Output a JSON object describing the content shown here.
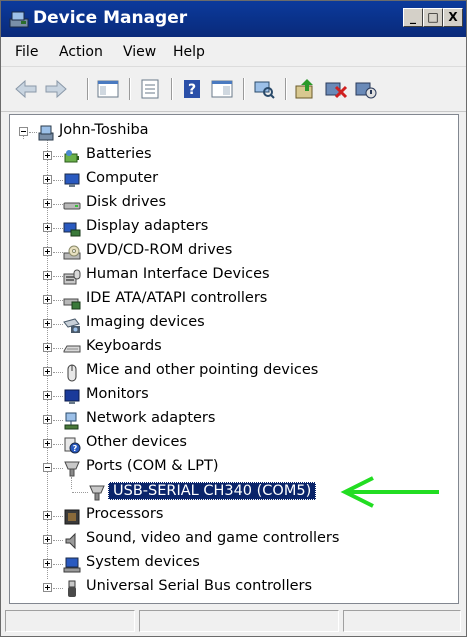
{
  "window": {
    "title": "Device Manager"
  },
  "title_buttons": {
    "minimize": "_",
    "maximize": "□",
    "close": "X"
  },
  "menu": {
    "items": [
      "File",
      "Action",
      "View",
      "Help"
    ]
  },
  "toolbar": {
    "icons": [
      "back-arrow-icon",
      "forward-arrow-icon",
      "show-hide-tree-icon",
      "properties-icon",
      "help-icon",
      "view-icon",
      "scan-hardware-icon",
      "update-driver-icon",
      "uninstall-icon",
      "disable-icon"
    ]
  },
  "tree": {
    "root": {
      "label": "John-Toshiba",
      "icon": "computer-icon"
    },
    "items": [
      {
        "label": "Batteries",
        "icon": "battery-icon",
        "expanded": false
      },
      {
        "label": "Computer",
        "icon": "monitor-icon",
        "expanded": false
      },
      {
        "label": "Disk drives",
        "icon": "disk-drive-icon",
        "expanded": false
      },
      {
        "label": "Display adapters",
        "icon": "display-adapter-icon",
        "expanded": false
      },
      {
        "label": "DVD/CD-ROM drives",
        "icon": "optical-drive-icon",
        "expanded": false
      },
      {
        "label": "Human Interface Devices",
        "icon": "hid-icon",
        "expanded": false
      },
      {
        "label": "IDE ATA/ATAPI controllers",
        "icon": "ide-controller-icon",
        "expanded": false
      },
      {
        "label": "Imaging devices",
        "icon": "camera-icon",
        "expanded": false
      },
      {
        "label": "Keyboards",
        "icon": "keyboard-icon",
        "expanded": false
      },
      {
        "label": "Mice and other pointing devices",
        "icon": "mouse-icon",
        "expanded": false
      },
      {
        "label": "Monitors",
        "icon": "monitor-icon",
        "expanded": false
      },
      {
        "label": "Network adapters",
        "icon": "network-icon",
        "expanded": false
      },
      {
        "label": "Other devices",
        "icon": "unknown-device-icon",
        "expanded": false
      },
      {
        "label": "Ports (COM & LPT)",
        "icon": "port-icon",
        "expanded": true
      },
      {
        "label": "USB-SERIAL CH340 (COM5)",
        "icon": "port-icon",
        "child": true,
        "selected": true
      },
      {
        "label": "Processors",
        "icon": "processor-icon",
        "expanded": false
      },
      {
        "label": "Sound, video and game controllers",
        "icon": "speaker-icon",
        "expanded": false
      },
      {
        "label": "System devices",
        "icon": "system-device-icon",
        "expanded": false
      },
      {
        "label": "Universal Serial Bus controllers",
        "icon": "usb-icon",
        "expanded": false
      }
    ]
  },
  "colors": {
    "selection": "#0a246a",
    "annotation_arrow": "#22dd22"
  }
}
